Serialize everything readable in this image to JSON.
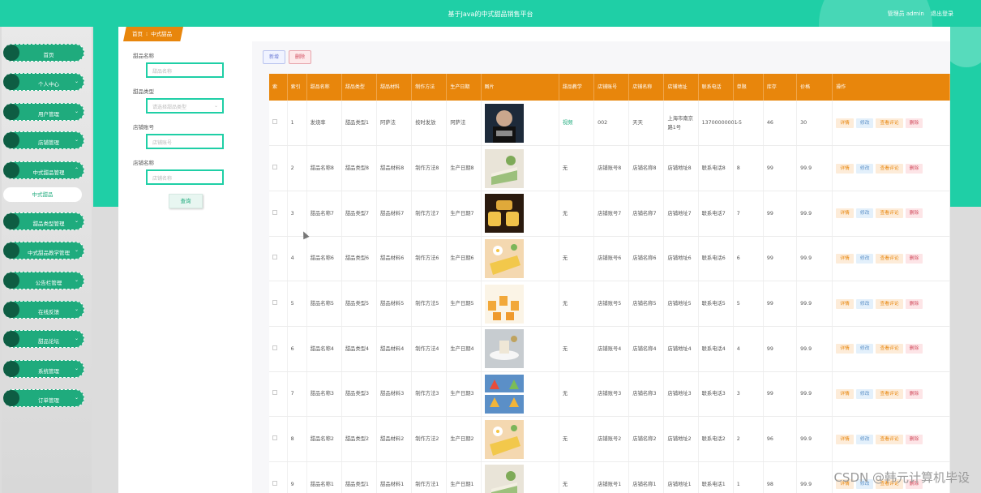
{
  "header": {
    "title": "基于Java的中式甜品销售平台",
    "user": "管理员 admin",
    "logout": "退出登录"
  },
  "sidebar": {
    "items": [
      {
        "label": "首页",
        "has_chevron": false
      },
      {
        "label": "个人中心",
        "has_chevron": true
      },
      {
        "label": "用户管理",
        "has_chevron": true
      },
      {
        "label": "店铺管理",
        "has_chevron": true
      },
      {
        "label": "中式甜品管理",
        "has_chevron": true,
        "expanded": true
      },
      {
        "label": "甜品类型管理",
        "has_chevron": true
      },
      {
        "label": "中式甜品教学管理",
        "has_chevron": true
      },
      {
        "label": "公告栏管理",
        "has_chevron": true
      },
      {
        "label": "在线反馈",
        "has_chevron": true
      },
      {
        "label": "甜品论坛",
        "has_chevron": true
      },
      {
        "label": "系统管理",
        "has_chevron": true
      },
      {
        "label": "订单管理",
        "has_chevron": true
      }
    ],
    "sub_item": "中式甜品"
  },
  "breadcrumb": {
    "home": "首页",
    "sep": "⁝",
    "current": "中式甜品"
  },
  "search": {
    "fields": [
      {
        "label": "甜品名称",
        "placeholder": "甜品名称"
      },
      {
        "label": "甜品类型",
        "placeholder": "请选择甜品类型",
        "is_select": true
      },
      {
        "label": "店铺账号",
        "placeholder": "店铺账号"
      },
      {
        "label": "店铺名称",
        "placeholder": "店铺名称"
      }
    ],
    "button": "查询"
  },
  "toolbar": {
    "add": "新增",
    "delete": "删除"
  },
  "table": {
    "columns": [
      "索",
      "索引",
      "甜品名称",
      "甜品类型",
      "甜品材料",
      "制作方法",
      "生产日期",
      "图片",
      "甜品教学",
      "店铺账号",
      "店铺名称",
      "店铺地址",
      "联系电话",
      "单限",
      "库存",
      "价格",
      "操作"
    ],
    "rows": [
      {
        "idx": "1",
        "name": "发烧率",
        "type": "甜品类型1",
        "material": "阿萨法",
        "method": "按时发放",
        "date": "阿萨法",
        "teach": "视频",
        "account": "002",
        "shop": "天天",
        "addr": "上海市南京路1号",
        "phone": "13700000001",
        "limit": "-5",
        "stock": "46",
        "price": "30"
      },
      {
        "idx": "2",
        "name": "甜品名称8",
        "type": "甜品类型8",
        "material": "甜品材料8",
        "method": "制作方法8",
        "date": "生产日期8",
        "teach": "无",
        "account": "店铺账号8",
        "shop": "店铺名称8",
        "addr": "店铺地址8",
        "phone": "联系电话8",
        "limit": "8",
        "stock": "99",
        "price": "99.9"
      },
      {
        "idx": "3",
        "name": "甜品名称7",
        "type": "甜品类型7",
        "material": "甜品材料7",
        "method": "制作方法7",
        "date": "生产日期7",
        "teach": "无",
        "account": "店铺账号7",
        "shop": "店铺名称7",
        "addr": "店铺地址7",
        "phone": "联系电话7",
        "limit": "7",
        "stock": "99",
        "price": "99.9"
      },
      {
        "idx": "4",
        "name": "甜品名称6",
        "type": "甜品类型6",
        "material": "甜品材料6",
        "method": "制作方法6",
        "date": "生产日期6",
        "teach": "无",
        "account": "店铺账号6",
        "shop": "店铺名称6",
        "addr": "店铺地址6",
        "phone": "联系电话6",
        "limit": "6",
        "stock": "99",
        "price": "99.9"
      },
      {
        "idx": "5",
        "name": "甜品名称5",
        "type": "甜品类型5",
        "material": "甜品材料5",
        "method": "制作方法5",
        "date": "生产日期5",
        "teach": "无",
        "account": "店铺账号5",
        "shop": "店铺名称5",
        "addr": "店铺地址5",
        "phone": "联系电话5",
        "limit": "5",
        "stock": "99",
        "price": "99.9"
      },
      {
        "idx": "6",
        "name": "甜品名称4",
        "type": "甜品类型4",
        "material": "甜品材料4",
        "method": "制作方法4",
        "date": "生产日期4",
        "teach": "无",
        "account": "店铺账号4",
        "shop": "店铺名称4",
        "addr": "店铺地址4",
        "phone": "联系电话4",
        "limit": "4",
        "stock": "99",
        "price": "99.9"
      },
      {
        "idx": "7",
        "name": "甜品名称3",
        "type": "甜品类型3",
        "material": "甜品材料3",
        "method": "制作方法3",
        "date": "生产日期3",
        "teach": "无",
        "account": "店铺账号3",
        "shop": "店铺名称3",
        "addr": "店铺地址3",
        "phone": "联系电话3",
        "limit": "3",
        "stock": "99",
        "price": "99.9"
      },
      {
        "idx": "8",
        "name": "甜品名称2",
        "type": "甜品类型2",
        "material": "甜品材料2",
        "method": "制作方法2",
        "date": "生产日期2",
        "teach": "无",
        "account": "店铺账号2",
        "shop": "店铺名称2",
        "addr": "店铺地址2",
        "phone": "联系电话2",
        "limit": "2",
        "stock": "96",
        "price": "99.9"
      },
      {
        "idx": "9",
        "name": "甜品名称1",
        "type": "甜品类型1",
        "material": "甜品材料1",
        "method": "制作方法1",
        "date": "生产日期1",
        "teach": "无",
        "account": "店铺账号1",
        "shop": "店铺名称1",
        "addr": "店铺地址1",
        "phone": "联系电话1",
        "limit": "1",
        "stock": "98",
        "price": "99.9"
      }
    ],
    "actions": {
      "detail": "详情",
      "edit": "修改",
      "review": "查看评论",
      "delete": "删除"
    }
  },
  "watermark": "CSDN @韩元计算机毕设",
  "colors": {
    "teal": "#1fcfa6",
    "menu_green": "#1fab7d",
    "orange": "#e8860c"
  }
}
